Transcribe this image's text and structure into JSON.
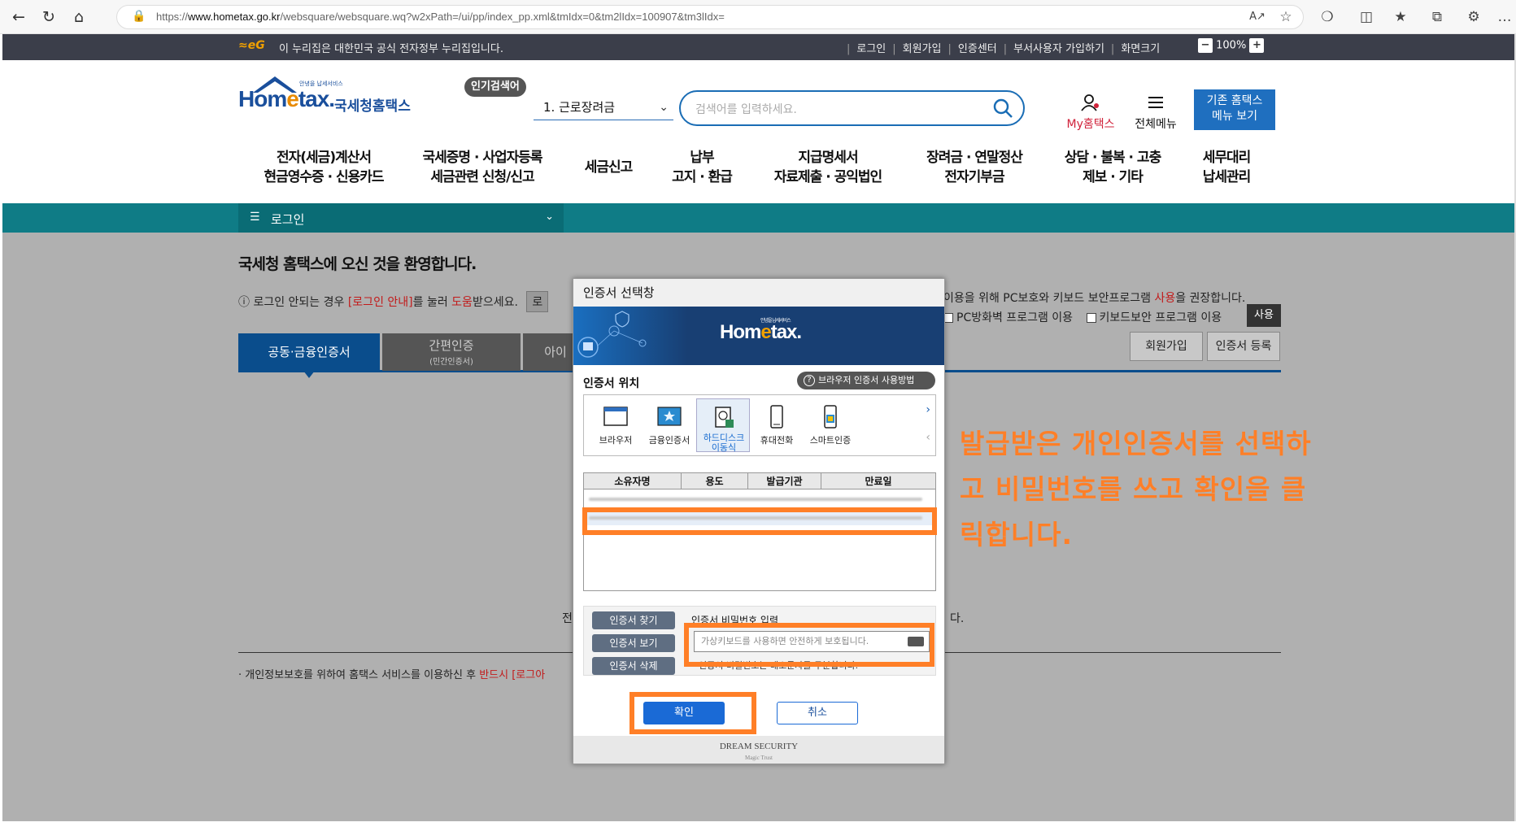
{
  "browser": {
    "url_prefix": "https://",
    "url_host": "www.hometax.go.kr",
    "url_path": "/websquare/websquare.wq?w2xPath=/ui/pp/index_pp.xml&tmIdx=0&tm2lIdx=100907&tm3lIdx="
  },
  "util_bar": {
    "notice": "이 누리집은 대한민국 공식 전자정부 누리집입니다.",
    "links": [
      "로그인",
      "회원가입",
      "인증센터",
      "부서사용자 가입하기",
      "화면크기"
    ],
    "zoom_minus": "−",
    "zoom_value": "100%",
    "zoom_plus": "+"
  },
  "header": {
    "logo_word_a": "Hom",
    "logo_word_b": "e",
    "logo_word_c": "tax.",
    "logo_tagline": "안녕을 납세서비스",
    "logo_kor": "국세청홈택스",
    "popular_label": "인기검색어",
    "popular_value": "1.  근로장려금",
    "search_placeholder": "검색어를 입력하세요.",
    "my_hometax": "My홈택스",
    "all_menu": "전체메뉴",
    "old_menu_line1": "기존 홈택스",
    "old_menu_line2": "메뉴 보기"
  },
  "gnb": [
    {
      "l1": "전자(세금)계산서",
      "l2": "현금영수증 · 신용카드"
    },
    {
      "l1": "국세증명 · 사업자등록",
      "l2": "세금관련 신청/신고"
    },
    {
      "l1": "세금신고",
      "l2": ""
    },
    {
      "l1": "납부",
      "l2": "고지 · 환급"
    },
    {
      "l1": "지급명세서",
      "l2": "자료제출 · 공익법인"
    },
    {
      "l1": "장려금 · 연말정산",
      "l2": "전자기부금"
    },
    {
      "l1": "상담 · 불복 · 고충",
      "l2": "제보 · 기타"
    },
    {
      "l1": "세무대리",
      "l2": "납세관리"
    }
  ],
  "location": {
    "label": "로그인"
  },
  "content": {
    "welcome": "국세청 홈택스에 오신 것을 환영합니다.",
    "help_a": "로그인 안되는 경우 ",
    "help_link": "[로그인 안내]",
    "help_b": "를 눌러 ",
    "help_red": "도움",
    "help_c": "받으세요.",
    "help_cut": "로",
    "right_a": "이용을 위해 PC보호와 키보드 보안프로그램 ",
    "right_red": "사용",
    "right_b": "을 권장합니다.",
    "check_firewall": "PC방화벽 프로그램 이용",
    "check_keyboard": "키보드보안 프로그램 이용",
    "use_button": "사용",
    "tab_cert": "공동·금융인증서",
    "tab_simple": "간편인증",
    "tab_simple_sub": "(민간인증서)",
    "tab_id": "아이",
    "join_button": "회원가입",
    "cert_register_button": "인증서 등록",
    "behind_left": "전",
    "behind_right": "다.",
    "privacy_a": "· 개인정보보호를 위하여 홈택스 서비스를 이용하신 후 ",
    "privacy_red": "반드시 [로그아"
  },
  "dialog": {
    "title": "인증서 선택창",
    "banner_a": "Hom",
    "banner_b": "e",
    "banner_c": "tax.",
    "banner_tag": "안녕을 납세서비스",
    "location_label": "인증서 위치",
    "browser_guide": "브라우저 인증서 사용방법",
    "media": [
      {
        "label": "브라우저",
        "icon": "browser-icon"
      },
      {
        "label": "금융인증서",
        "icon": "financial-cert-icon"
      },
      {
        "label": "하드디스크\n이동식",
        "icon": "harddisk-icon"
      },
      {
        "label": "휴대전화",
        "icon": "mobile-phone-icon"
      },
      {
        "label": "스마트인증",
        "icon": "smart-cert-icon"
      }
    ],
    "columns": [
      "소유자명",
      "용도",
      "발급기관",
      "만료일"
    ],
    "find_button": "인증서 찾기",
    "view_button": "인증서 보기",
    "delete_button": "인증서 삭제",
    "pw_label": "인증서 비밀번호 입력",
    "pw_placeholder": "가상키보드를 사용하면 안전하게 보호됩니다.",
    "pw_note": "* 인증서 비밀번호는 대소문자를 구분합니다.",
    "ok_button": "확인",
    "cancel_button": "취소",
    "footer_brand": "DREAM SECURITY",
    "footer_sub": "Magic Trust"
  },
  "annotation": {
    "line1": "발급받은 개인인증서를 선택하",
    "line2": "고 비밀번호를 쓰고 확인을 클",
    "line3": "릭합니다.",
    "color": "#ff7f27"
  }
}
